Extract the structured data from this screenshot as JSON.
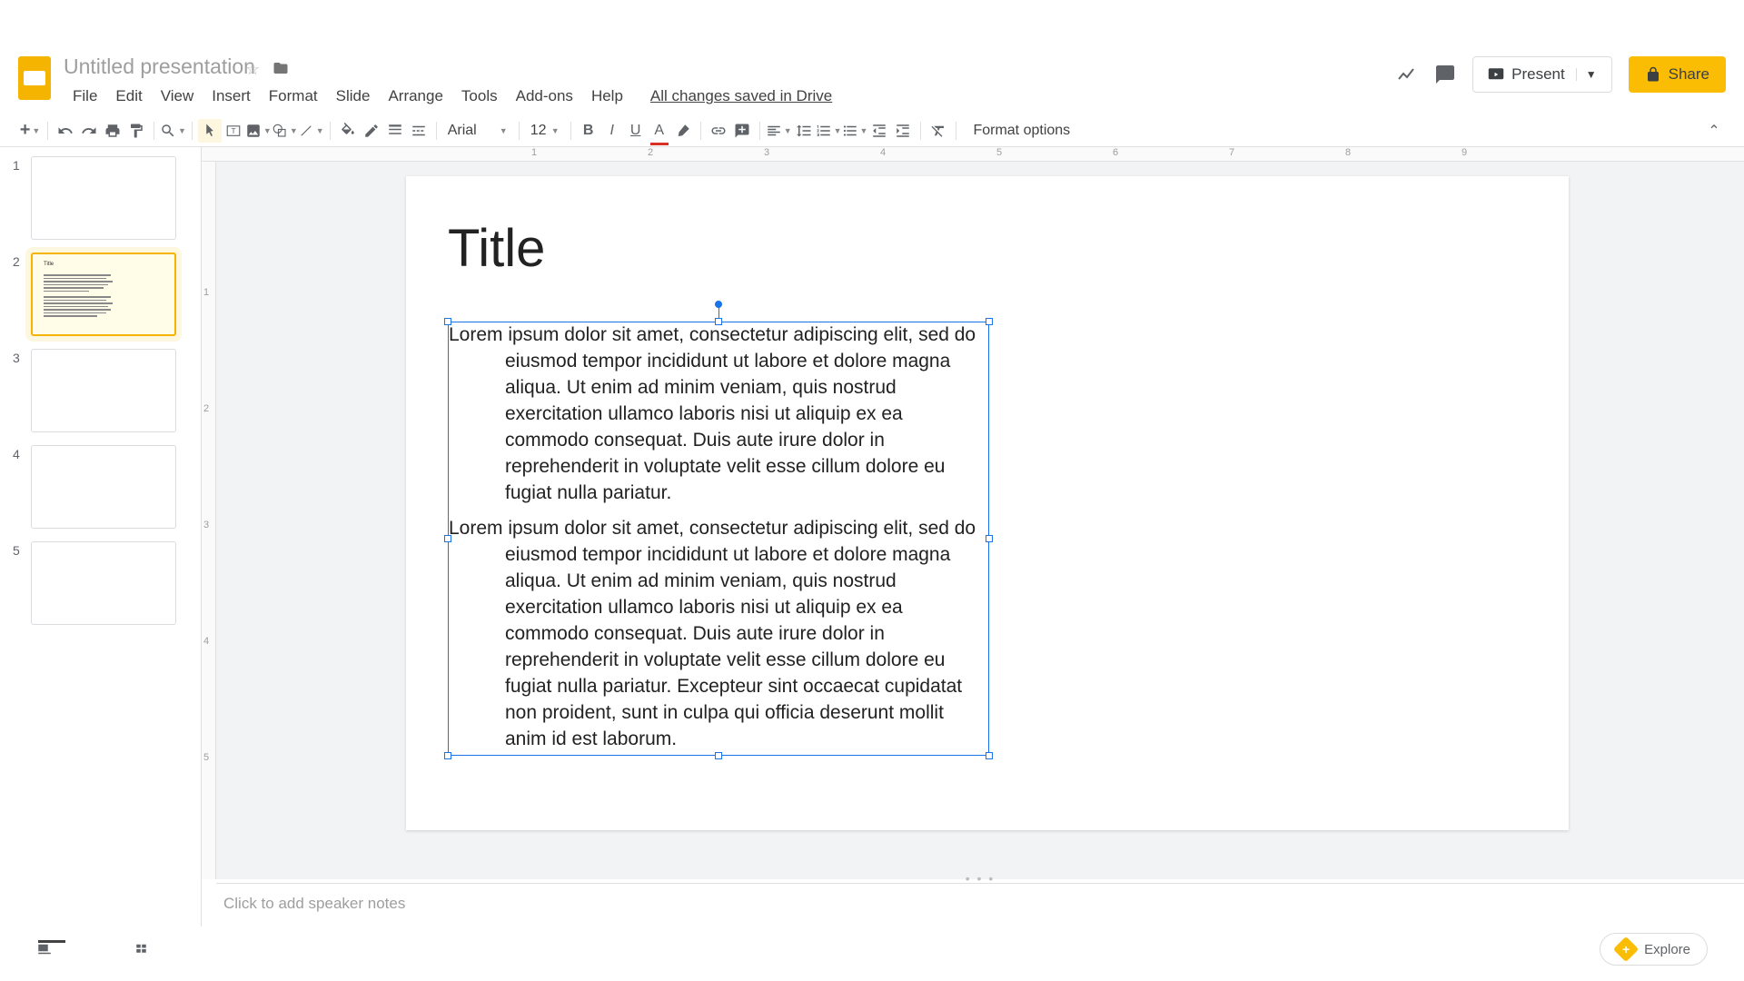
{
  "doc": {
    "title": "Untitled presentation",
    "save_status": "All changes saved in Drive"
  },
  "menus": {
    "file": "File",
    "edit": "Edit",
    "view": "View",
    "insert": "Insert",
    "format": "Format",
    "slide": "Slide",
    "arrange": "Arrange",
    "tools": "Tools",
    "addons": "Add-ons",
    "help": "Help"
  },
  "header_actions": {
    "present": "Present",
    "share": "Share"
  },
  "toolbar": {
    "font": "Arial",
    "font_size": "12",
    "format_options": "Format options"
  },
  "ruler_h": [
    "1",
    "2",
    "3",
    "4",
    "5",
    "6",
    "7",
    "8",
    "9"
  ],
  "ruler_v": [
    "1",
    "2",
    "3",
    "4",
    "5"
  ],
  "thumbs": [
    "1",
    "2",
    "3",
    "4",
    "5"
  ],
  "slide": {
    "title": "Title",
    "para1": "Lorem ipsum dolor sit amet, consectetur adipiscing elit, sed do eiusmod tempor incididunt ut labore et dolore magna aliqua. Ut enim ad minim veniam, quis nostrud exercitation ullamco laboris nisi ut aliquip ex ea commodo consequat. Duis aute irure dolor in reprehenderit in voluptate velit esse cillum dolore eu fugiat nulla pariatur.",
    "para2": "Lorem ipsum dolor sit amet, consectetur adipiscing elit, sed do eiusmod tempor incididunt ut labore et dolore magna aliqua. Ut enim ad minim veniam, quis nostrud exercitation ullamco laboris nisi ut aliquip ex ea commodo consequat. Duis aute irure dolor in reprehenderit in voluptate velit esse cillum dolore eu fugiat nulla pariatur. Excepteur sint occaecat cupidatat non proident, sunt in culpa qui officia deserunt mollit anim id est laborum."
  },
  "speaker_notes_placeholder": "Click to add speaker notes",
  "bottom": {
    "explore": "Explore"
  }
}
